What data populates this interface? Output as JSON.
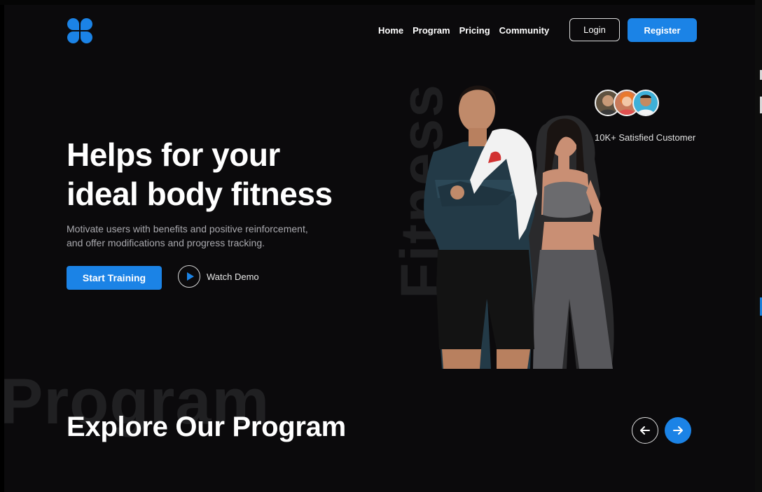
{
  "nav": {
    "items": [
      "Home",
      "Program",
      "Pricing",
      "Community"
    ],
    "login_label": "Login",
    "register_label": "Register"
  },
  "hero": {
    "title_line1": "Helps for your",
    "title_line2": "ideal body fitness",
    "subtitle_line1": "Motivate users with benefits and positive reinforcement,",
    "subtitle_line2": "and offer modifications and progress tracking.",
    "start_label": "Start Training",
    "watch_label": "Watch Demo",
    "background_word": "Fitness"
  },
  "social_proof": {
    "customers_label": "10K+ Satisfied Customer"
  },
  "explore": {
    "background_word": "Program",
    "title": "Explore Our Program"
  },
  "colors": {
    "accent": "#1b83e6",
    "background": "#0b0a0c"
  }
}
